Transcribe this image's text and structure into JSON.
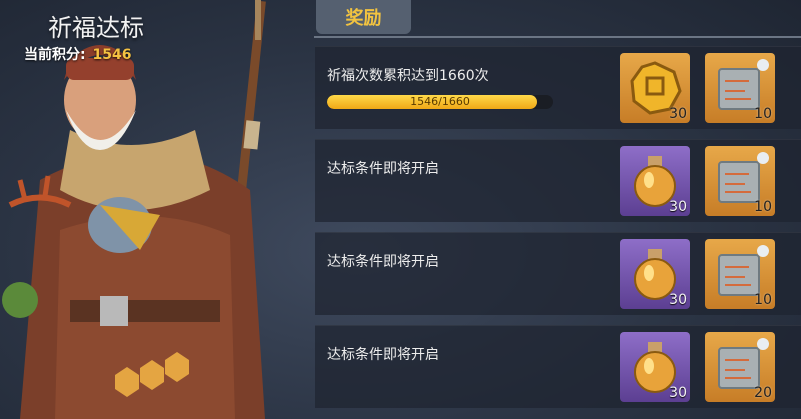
{
  "header": {
    "title": "祈福达标",
    "score_label": "当前积分:",
    "score_value": "1546"
  },
  "tab": {
    "label": "奖励"
  },
  "colors": {
    "accent": "#f2c340",
    "gold_bg": "#e7a849",
    "purple_bg": "#8e6ec8"
  },
  "rows": [
    {
      "text": "祈福次数累积达到1660次",
      "progress": {
        "current": 1546,
        "total": 1660,
        "label": "1546/1660"
      },
      "rewards": [
        {
          "icon": "gold-coin-icon",
          "count": "30"
        },
        {
          "icon": "map-piece-icon",
          "count": "10"
        }
      ]
    },
    {
      "text": "达标条件即将开启",
      "rewards": [
        {
          "icon": "potion-jar-icon",
          "count": "30"
        },
        {
          "icon": "map-piece-icon",
          "count": "10"
        }
      ]
    },
    {
      "text": "达标条件即将开启",
      "rewards": [
        {
          "icon": "potion-jar-icon",
          "count": "30"
        },
        {
          "icon": "map-piece-icon",
          "count": "10"
        }
      ]
    },
    {
      "text": "达标条件即将开启",
      "rewards": [
        {
          "icon": "potion-jar-icon",
          "count": "30"
        },
        {
          "icon": "map-piece-icon",
          "count": "20"
        }
      ]
    }
  ]
}
